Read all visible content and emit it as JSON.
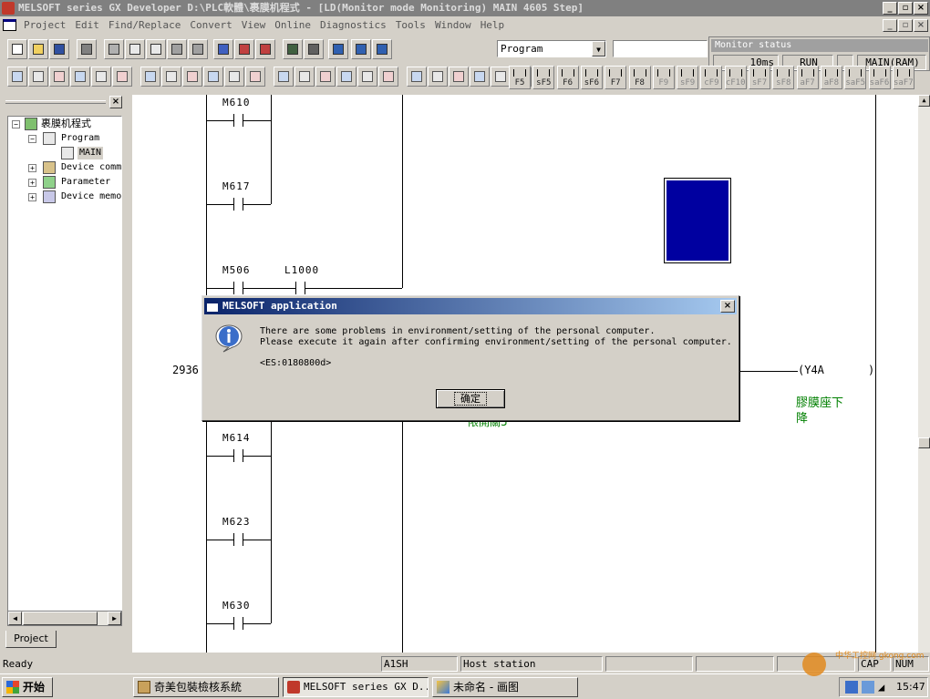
{
  "window": {
    "title": "MELSOFT series GX Developer D:\\PLC軟體\\裹膜机程式 - [LD(Monitor mode Monitoring)    MAIN    4605 Step]"
  },
  "menu": [
    "Project",
    "Edit",
    "Find/Replace",
    "Convert",
    "View",
    "Online",
    "Diagnostics",
    "Tools",
    "Window",
    "Help"
  ],
  "program_combo": {
    "value": "Program"
  },
  "monitor_status": {
    "title": "Monitor status",
    "scan": "10ms",
    "state": "RUN",
    "memory": "MAIN(RAM)"
  },
  "fkeys": [
    "F5",
    "sF5",
    "F6",
    "sF6",
    "F7",
    "F8",
    "F9",
    "sF9",
    "cF9",
    "cF10",
    "sF7",
    "sF8",
    "aF7",
    "aF8",
    "saF5",
    "saF6",
    "saF7"
  ],
  "project_tree": {
    "root": "裹膜机程式",
    "items": [
      "Program",
      "MAIN",
      "Device comm",
      "Parameter",
      "Device memo"
    ],
    "tab": "Project"
  },
  "ladder": {
    "contacts": [
      "M610",
      "M617",
      "M506",
      "L1000",
      "M614",
      "M623",
      "M630"
    ],
    "step_number": "2936",
    "coil": "Y4A",
    "coil_comment": [
      "膠膜座下",
      "降"
    ],
    "partial_comment": "限開關5"
  },
  "dialog": {
    "title": "MELSOFT application",
    "line1": "There are some problems in environment/setting of the personal computer.",
    "line2": "Please execute it again after confirming environment/setting of the personal computer.",
    "error_code": "<ES:0180800d>",
    "ok_label": "确定",
    "info_icon": "info-icon"
  },
  "statusbar": {
    "ready": "Ready",
    "cpu": "A1SH",
    "station": "Host station",
    "caps": "CAP",
    "num": "NUM"
  },
  "taskbar": {
    "start": "开始",
    "tasks": [
      "奇美包裝檢核系統",
      "MELSOFT series GX D...",
      "未命名 - 画图"
    ],
    "clock": "15:47",
    "watermark": "中华工控网 gkong.com"
  },
  "colors": {
    "title_active": "#0a246a",
    "title_inactive": "#808080",
    "comment_green": "#008000",
    "blue_block": "#0000a0"
  }
}
